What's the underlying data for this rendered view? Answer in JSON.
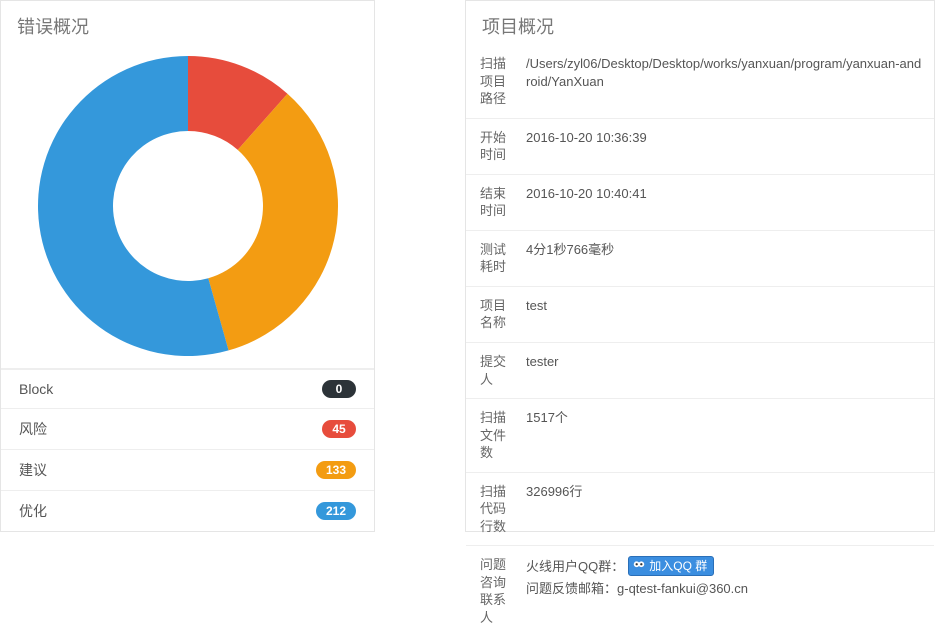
{
  "left": {
    "title": "错误概况",
    "stats": [
      {
        "label": "Block",
        "count": 0,
        "color": "#2c3338"
      },
      {
        "label": "风险",
        "count": 45,
        "color": "#e74c3c"
      },
      {
        "label": "建议",
        "count": 133,
        "color": "#f39c12"
      },
      {
        "label": "优化",
        "count": 212,
        "color": "#3498db"
      }
    ]
  },
  "chart_data": {
    "type": "pie",
    "title": "错误概况",
    "categories": [
      "Block",
      "风险",
      "建议",
      "优化"
    ],
    "values": [
      0,
      45,
      133,
      212
    ],
    "colors": [
      "#2c3338",
      "#e74c3c",
      "#f39c12",
      "#3498db"
    ],
    "donut_inner_ratio": 0.5
  },
  "right": {
    "title": "项目概况",
    "rows": [
      {
        "label": "扫描项目路径",
        "value": "/Users/zyl06/Desktop/Desktop/works/yanxuan/program/yanxuan-android/YanXuan"
      },
      {
        "label": "开始时间",
        "value": "2016-10-20 10:36:39"
      },
      {
        "label": "结束时间",
        "value": "2016-10-20 10:40:41"
      },
      {
        "label": "测试耗时",
        "value": "4分1秒766毫秒"
      },
      {
        "label": "项目名称",
        "value": "test"
      },
      {
        "label": "提交人",
        "value": "tester"
      },
      {
        "label": "扫描文件数",
        "value": "1517个"
      },
      {
        "label": "扫描代码行数",
        "value": "326996行"
      }
    ],
    "contact": {
      "label": "问题咨询联系人",
      "qq_prefix": "火线用户QQ群：",
      "qq_button": "加入QQ 群",
      "email_prefix": "问题反馈邮箱：",
      "email": "g-qtest-fankui@360.cn"
    }
  }
}
